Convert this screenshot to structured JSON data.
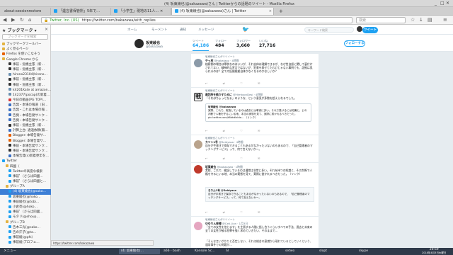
{
  "window": {
    "title": "(4) 坂東綾也(@sakazawa)さん | Twitterからの話題のツイート - Mozilla Firefox",
    "controls": [
      "_",
      "□",
      "✕"
    ]
  },
  "tabs": [
    {
      "label": "about:sessionrestore"
    },
    {
      "label": "「遺言書保管所」5年で…"
    },
    {
      "label": "「小学生」現地の11人… ✕"
    },
    {
      "label": "(4) 坂東綾也(@sakazawa)さん | Twitter"
    }
  ],
  "nav": {
    "url_site": "Twitter, Inc. (US)",
    "url": "https://twitter.com/bakazawa/with_replies",
    "search_placeholder": "検索"
  },
  "sidebar": {
    "title": "ブックマーク",
    "search_placeholder": "ブックマークを検索",
    "items": [
      {
        "label": "ブックマークツールバー",
        "color": "#e3b341",
        "sel": false
      },
      {
        "label": "よく見るページ",
        "color": "#e3b341",
        "sel": false
      },
      {
        "label": "Firefox を使いこなそう",
        "color": "#e66000",
        "sel": false
      },
      {
        "label": "Google Chrome から",
        "color": "#e3b341",
        "sel": false
      },
      {
        "label": "事前・危機主張（新…",
        "color": "#333333",
        "sel": false
      },
      {
        "label": "事前・危機主張（新…",
        "color": "#333333",
        "sel": false
      },
      {
        "label": "hirono23104(hirono…",
        "color": "#6a8fb0",
        "sel": false
      },
      {
        "label": "事前・危機主張（新…",
        "color": "#333333",
        "sel": false
      },
      {
        "label": "事前・危機主張（新…",
        "color": "#333333",
        "sel": false
      },
      {
        "label": "k4201Kate at amazon…",
        "color": "#6a8fb0",
        "sel": false
      },
      {
        "label": "142377(pocap)の新着…",
        "color": "#6a8fb0",
        "sel": false
      },
      {
        "label": "今日の動画(PG TOP)…",
        "color": "#d33",
        "sel": false
      },
      {
        "label": "告発・本場の報道（旧…",
        "color": "#3b6fc4",
        "sel": false
      },
      {
        "label": "告発・これは本場の報…",
        "color": "#3b6fc4",
        "sel": false
      },
      {
        "label": "告発・本場告発サンク…",
        "color": "#3b6fc4",
        "sel": false
      },
      {
        "label": "告発・本場告発サンク…",
        "color": "#3b6fc4",
        "sel": false
      },
      {
        "label": "事前・危機主張（新…",
        "color": "#333333",
        "sel": false
      },
      {
        "label": "計算上台: 通過依頼(無…",
        "color": "#3b6fc4",
        "sel": false
      },
      {
        "label": "Blogger: 本場告発サ…",
        "color": "#e66000",
        "sel": false
      },
      {
        "label": "Blogger: 本場告発サ…",
        "color": "#e66000",
        "sel": false
      },
      {
        "label": "事前・本場告発サンク…",
        "color": "#333333",
        "sel": false
      },
      {
        "label": "事前・本場告発サンク…",
        "color": "#333333",
        "sel": false
      },
      {
        "label": "本場告発(s)新着更年を…",
        "color": "#3b6fc4",
        "sel": false
      },
      {
        "label": "Twitter",
        "color": "#1da1f2",
        "sel": false
      },
      {
        "label": "四國（",
        "color": "#e3b341",
        "sel": false
      },
      {
        "label": "Twitterの高度な検索",
        "color": "#1da1f2",
        "sel": false
      },
      {
        "label": "事前ﾟ（さらば四國…",
        "color": "#1da1f2",
        "sel": false
      },
      {
        "label": "事前ﾟ（さらば四國と…",
        "color": "#1da1f2",
        "sel": false
      },
      {
        "label": "グループA",
        "color": "#e3b341",
        "sel": false
      },
      {
        "label": "(4) 坂東綾也(@saka…",
        "color": "#1da1f2",
        "sel": true
      },
      {
        "label": "坂東綾也(@hoko…",
        "color": "#1da1f2",
        "sel": false
      },
      {
        "label": "事前綾也(@tobi…",
        "color": "#1da1f2",
        "sel": false
      },
      {
        "label": "小倉亮(@hoko…",
        "color": "#1da1f2",
        "sel": false
      },
      {
        "label": "事前ﾟ（さらば四國…",
        "color": "#1da1f2",
        "sel": false
      },
      {
        "label": "モタリ(@shoup…",
        "color": "#1da1f2",
        "sel": false
      },
      {
        "label": "グループB",
        "color": "#e3b341",
        "sel": false
      },
      {
        "label": "告木三光(@sako…",
        "color": "#1da1f2",
        "sel": false
      },
      {
        "label": "告の汗子(@ta…",
        "color": "#1da1f2",
        "sel": false
      },
      {
        "label": "事前綾(@pfs）",
        "color": "#1da1f2",
        "sel": false
      },
      {
        "label": "事前綾(プロフェ…",
        "color": "#1da1f2",
        "sel": false
      }
    ]
  },
  "twitter": {
    "nav": [
      "ホーム",
      "モーメント",
      "通知",
      "メッセージ"
    ],
    "search_placeholder": "キーワード検索",
    "tweet_button": "ツイート",
    "profile": {
      "name": "坂東綾也",
      "handle": "@bakazawa",
      "follow_label": "フォローする"
    },
    "stats": [
      {
        "label": "ツイート",
        "value": "64,186"
      },
      {
        "label": "フォロー",
        "value": "484"
      },
      {
        "label": "フォロワー",
        "value": "3,660"
      },
      {
        "label": "いいね",
        "value": "27,716"
      }
    ],
    "tweets": [
      {
        "context": "坂東綾也さんがリツイート",
        "name": "やっ柱",
        "handle": "@nakataoz · 4時間",
        "text": "検察側の場合は罪状なのはいいが、それ自体は理解できるが、なぜ性自認に関して裏付けされてない、精神的な宣言ではないが、犯意を表せてたわけじゃない事例でも、証拠は見られるのは？全ての証拠根拠自体がなくなるのかなしいか？"
      },
      {
        "context": "坂東綾也さんがリツイート",
        "name": "裁判所を動かすために",
        "handle": "@HimtoonDesi · 4時間",
        "text": "「それはちょっとなぁ」のような、という意見が多数を超えられるでした。",
        "quote_name": "坂東綾也 @bakazawa",
        "quote_text": "実際、これで、実施しているのは過去には事実に多い。それで受けるには知識と、どの判断で人権を守るにいる地、本当の実態を見て、実際に書かれるべきだった。pic.twitter.com/t6bkdlxIda…",
        "quote_link": "（リンク）"
      },
      {
        "context": "坂東綾也さんがリツイート",
        "name": "カツン1号",
        "handle": "@Seidyasa · 4時間",
        "text": "自分が手書きで保存できることもあるがなかったいないのもあるので、「自己管理者のマッチングサービス」って、何て言えないかー。"
      },
      {
        "context": "",
        "name": "坂東綾也",
        "handle": "@bakazawa · 1時間",
        "text": "実際、これで、検証しているのは通常は非常に多い。それを持つの知識と、その判断で人権を守るにいる地、本当の実態を見て、実際に書かれるべきだった。（リンク）",
        "reply_name": "きりん1号 @Seidyasa",
        "reply_text": "自分が手書きで保存できることもあるがなかったいないのもあるので、「自己管理者のマッチングサービス」って、何て言えないかー。"
      },
      {
        "context": "坂東綾也さんがリツイート",
        "name": "ゆゆりん梓様",
        "handle": "@Ceti_lion · 1月3日",
        "text": "「全ての女性を信じます」を主張する人間に話し合うくらいすべての手法、過去と未来の全ての女性が被る犯罪を強く求めていきたい、そのままで…",
        "extra": "「そんな言いがかりと否定しない、それは総合の意識から現れているとしていくという、通常事件での問題が…"
      }
    ]
  },
  "statusbar": "https://twitter.com/bakazawa",
  "taskbar": {
    "items": [
      "メニュー",
      "(4) 坂東綾也(…",
      "a66 - bash",
      "Konsole Sc…",
      "SI",
      "setwo",
      "slopt",
      "skype"
    ],
    "time": "20:59",
    "date": "2018年4月3日木曜日"
  },
  "colors": {
    "accent": "#1da1f2",
    "selection": "#3d7fd6"
  }
}
